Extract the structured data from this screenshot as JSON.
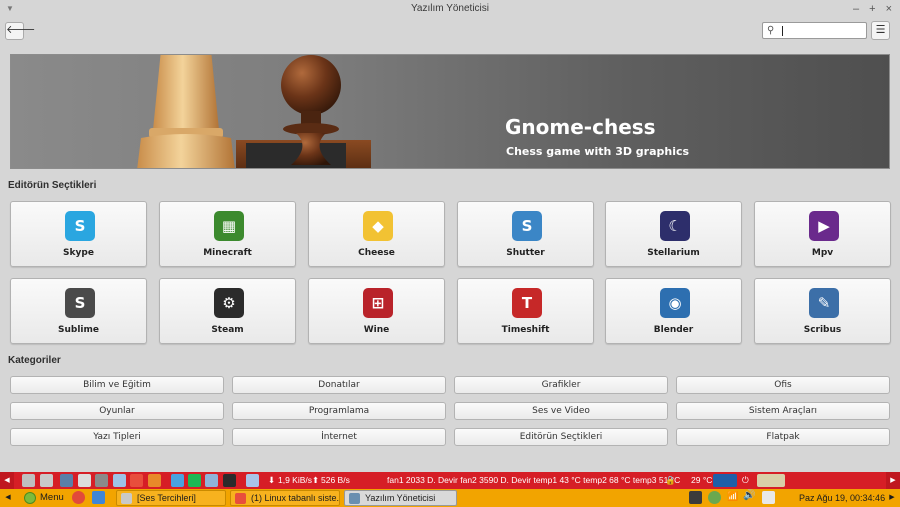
{
  "window": {
    "title": "Yazılım Yöneticisi",
    "controls": [
      "–",
      "+",
      "×"
    ]
  },
  "toolbar": {
    "back_icon": "back-arrow-icon",
    "search_placeholder": "",
    "menu_icon": "hamburger-menu-icon"
  },
  "banner": {
    "title": "Gnome-chess",
    "subtitle": "Chess game with 3D graphics"
  },
  "editors_picks": {
    "heading": "Editörün Seçtikleri",
    "apps": [
      {
        "name": "Skype",
        "icon": "skype-icon",
        "color": "#2aa6e0"
      },
      {
        "name": "Minecraft",
        "icon": "minecraft-icon",
        "color": "#3c8a2e"
      },
      {
        "name": "Cheese",
        "icon": "cheese-icon",
        "color": "#f2c233"
      },
      {
        "name": "Shutter",
        "icon": "shutter-icon",
        "color": "#3b86c6"
      },
      {
        "name": "Stellarium",
        "icon": "stellarium-icon",
        "color": "#2d2e6b"
      },
      {
        "name": "Mpv",
        "icon": "mpv-icon",
        "color": "#6a2a8c"
      },
      {
        "name": "Sublime",
        "icon": "sublime-icon",
        "color": "#4a4a4a"
      },
      {
        "name": "Steam",
        "icon": "steam-icon",
        "color": "#2b2b2b"
      },
      {
        "name": "Wine",
        "icon": "wine-icon",
        "color": "#b9232a"
      },
      {
        "name": "Timeshift",
        "icon": "timeshift-icon",
        "color": "#c62828"
      },
      {
        "name": "Blender",
        "icon": "blender-icon",
        "color": "#2d6fb0"
      },
      {
        "name": "Scribus",
        "icon": "scribus-icon",
        "color": "#3c6fa8"
      }
    ]
  },
  "categories": {
    "heading": "Kategoriler",
    "items": [
      "Bilim ve Eğitim",
      "Donatılar",
      "Grafikler",
      "Ofis",
      "Oyunlar",
      "Programlama",
      "Ses ve Video",
      "Sistem Araçları",
      "Yazı Tipleri",
      "İnternet",
      "Editörün Seçtikleri",
      "Flatpak"
    ]
  },
  "top_panel": {
    "net_down": "1,9 KiB/s",
    "net_up": "526 B/s",
    "sensors": "fan1 2033 D. Devir fan2 3590 D. Devir temp1 43 °C temp2 68 °C temp3 51 °C",
    "temp": "29 °C"
  },
  "bottom_panel": {
    "menu_label": "Menu",
    "tasks": [
      {
        "label": "[Ses Tercihleri]",
        "icon": "sound-settings-icon",
        "active": false
      },
      {
        "label": "(1) Linux tabanlı siste...",
        "icon": "chrome-icon",
        "active": false
      },
      {
        "label": "Yazılım Yöneticisi",
        "icon": "software-manager-icon",
        "active": true
      }
    ],
    "clock": "Paz Ağu 19, 00:34:46"
  }
}
